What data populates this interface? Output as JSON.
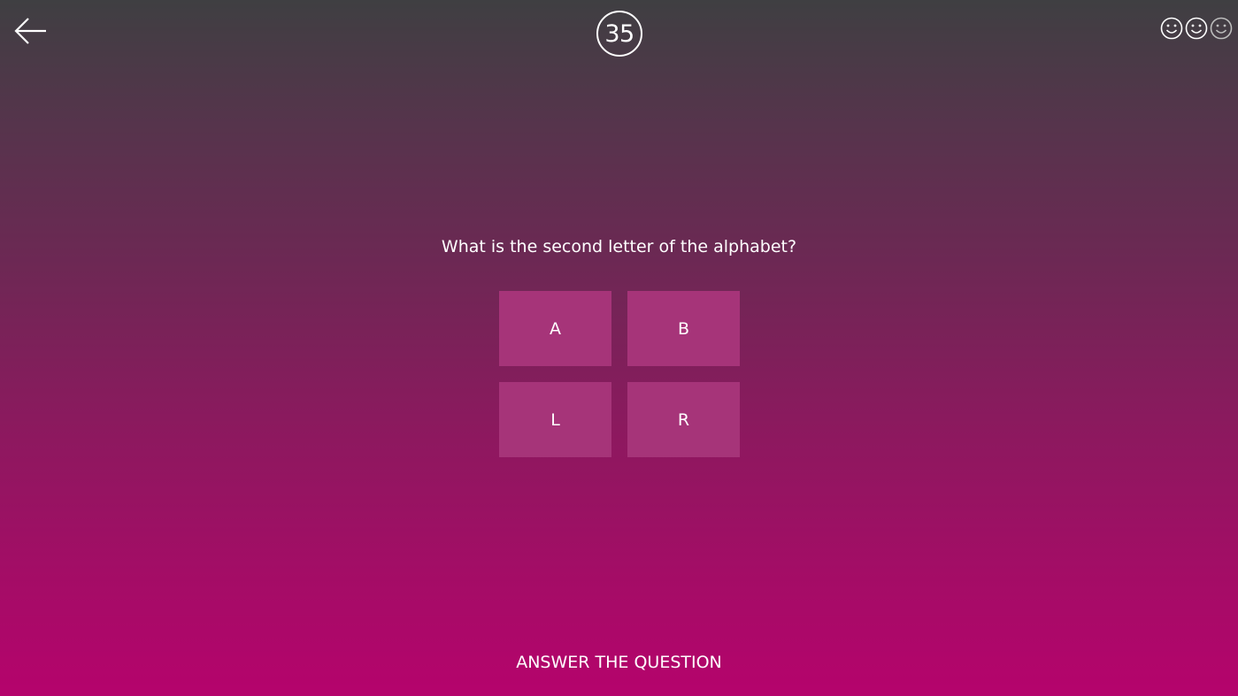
{
  "header": {
    "back_icon": "back-arrow-icon",
    "question_number": "35",
    "lives": [
      {
        "icon": "smiley-icon",
        "state": "active",
        "color": "#ffffff"
      },
      {
        "icon": "smiley-icon",
        "state": "active",
        "color": "#ffffff"
      },
      {
        "icon": "smiley-icon",
        "state": "dimmed",
        "color": "#bdbdbd"
      }
    ]
  },
  "question": {
    "text": "What is the second letter of the alphabet?"
  },
  "answers": [
    {
      "label": "A"
    },
    {
      "label": "B"
    },
    {
      "label": "L"
    },
    {
      "label": "R"
    }
  ],
  "footer": {
    "prompt": "ANSWER THE QUESTION"
  },
  "colors": {
    "gradient_top": "#3f3f42",
    "gradient_bottom": "#b5036c",
    "answer_tile": "#a63479",
    "text": "#ffffff"
  }
}
